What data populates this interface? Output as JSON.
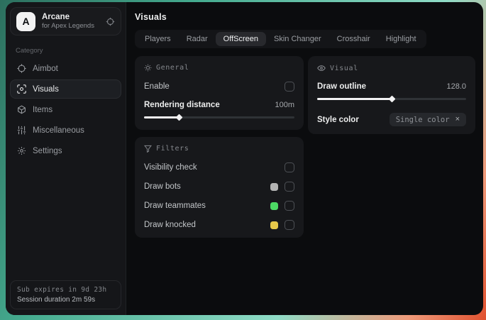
{
  "sidebar": {
    "logo": {
      "letter": "A",
      "title": "Arcane",
      "subtitle": "for Apex Legends"
    },
    "category_label": "Category",
    "items": [
      {
        "label": "Aimbot"
      },
      {
        "label": "Visuals"
      },
      {
        "label": "Items"
      },
      {
        "label": "Miscellaneous"
      },
      {
        "label": "Settings"
      }
    ],
    "footer": {
      "line1": "Sub expires in 9d 23h",
      "line2": "Session duration 2m 59s"
    }
  },
  "header": {
    "title": "Visuals"
  },
  "tabs": [
    {
      "label": "Players"
    },
    {
      "label": "Radar"
    },
    {
      "label": "OffScreen",
      "active": true
    },
    {
      "label": "Skin Changer"
    },
    {
      "label": "Crosshair"
    },
    {
      "label": "Highlight"
    }
  ],
  "sections": {
    "general": {
      "title": "General",
      "enable_label": "Enable",
      "enable_checked": false,
      "distance_label": "Rendering distance",
      "distance_value": "100m",
      "distance_fill": "23%"
    },
    "visual": {
      "title": "Visual",
      "outline_label": "Draw outline",
      "outline_value": "128.0",
      "outline_fill": "50%",
      "style_label": "Style color",
      "style_value": "Single color",
      "style_remove": "×"
    },
    "filters": {
      "title": "Filters",
      "rows": [
        {
          "label": "Visibility check",
          "checked": false
        },
        {
          "label": "Draw bots",
          "swatch": "#b3b3b3",
          "checked": false
        },
        {
          "label": "Draw teammates",
          "swatch": "#4cd964",
          "checked": false
        },
        {
          "label": "Draw knocked",
          "swatch": "#e6c84a",
          "checked": false
        }
      ]
    }
  }
}
